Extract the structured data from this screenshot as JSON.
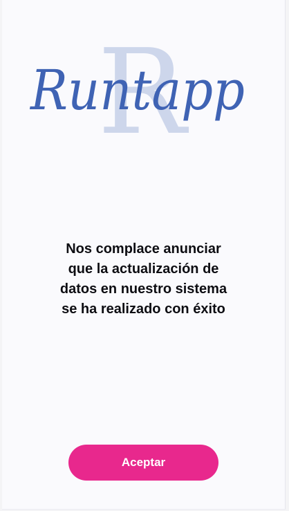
{
  "logo": {
    "text": "Runtapp",
    "watermark_letter": "R",
    "text_color": "#3f63b4",
    "watermark_color": "#c9d3ea"
  },
  "message": {
    "lines": [
      "Nos complace anunciar",
      "que la actualización de",
      "datos en nuestro sistema",
      "se ha realizado con éxito"
    ]
  },
  "accept_button": {
    "label": "Aceptar",
    "color": "#e8288d"
  }
}
